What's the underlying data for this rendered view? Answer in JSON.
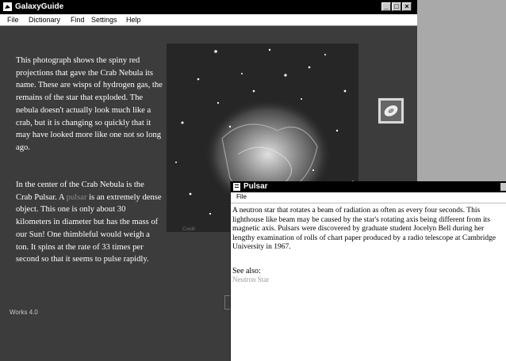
{
  "window": {
    "title": "GalaxyGuide",
    "buttons": {
      "minimize": "_",
      "maximize": "□",
      "close": "×"
    }
  },
  "menu": {
    "items": [
      "File",
      "Dictionary",
      "Find",
      "Settings",
      "Help"
    ]
  },
  "article": {
    "para1": "This photograph shows the spiny red projections that gave the Crab Nebula its name. These are wisps of hydrogen gas, the remains of the star that exploded. The nebula doesn't actually look much like a crab, but it is changing so quickly that it may have looked more like one not so long ago.",
    "para2_before": "In the center of the Crab Nebula is the Crab Pulsar. A ",
    "para2_link": "pulsar",
    "para2_after": " is an extremely dense object. This one is only about 30 kilometers in diameter but has the mass of our Sun! One thimbleful would weigh a ton. It spins at the rate of 33 times per second so that it seems to pulse rapidly.",
    "caption": "Credit",
    "footer": "Works 4.0"
  },
  "popup": {
    "title": "Pulsar",
    "file_menu": "File",
    "description": "A neutron star that rotates a beam of radiation as often as every four seconds. This lighthouse like beam may be caused by the star's rotating axis being different from its magnetic axis. Pulsars were discovered by graduate student Jocelyn Bell during her lengthy examination of rolls of chart paper produced by a radio telescope at Cambridge University in 1967.",
    "see_also_label": "See also:",
    "see_also_link": "Neutron Star"
  },
  "icons": {
    "app": "galaxy-app-icon",
    "popup": "document-icon",
    "thumbnail": "crab-nebula-thumbnail-icon"
  },
  "colors": {
    "content_bg": "#3c3c3c",
    "titlebar": "#000000",
    "desktop": "#a9a9a9"
  }
}
